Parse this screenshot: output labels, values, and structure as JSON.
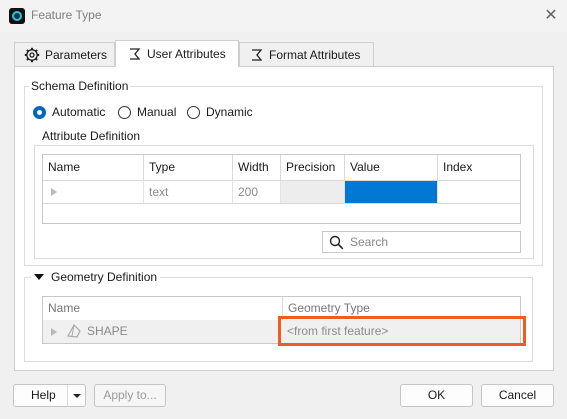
{
  "window": {
    "title": "Feature Type",
    "close_glyph": "✕",
    "icon": "app-icon"
  },
  "tabs": [
    {
      "label": "Parameters",
      "icon": "gear-icon",
      "active": false
    },
    {
      "label": "User Attributes",
      "icon": "sigma-icon",
      "active": true
    },
    {
      "label": "Format Attributes",
      "icon": "sigma-icon",
      "active": false
    }
  ],
  "schema": {
    "title": "Schema Definition",
    "options": [
      {
        "label": "Automatic",
        "checked": true
      },
      {
        "label": "Manual",
        "checked": false
      },
      {
        "label": "Dynamic",
        "checked": false
      }
    ]
  },
  "attributes": {
    "title": "Attribute Definition",
    "columns": [
      "Name",
      "Type",
      "Width",
      "Precision",
      "Value",
      "Index"
    ],
    "rows": [
      {
        "name": "",
        "type": "text",
        "width": "200",
        "precision": "",
        "value": "",
        "index": ""
      }
    ],
    "selected_color": "#0078d4"
  },
  "search": {
    "placeholder": "Search",
    "icon": "search-icon"
  },
  "geometry": {
    "title": "Geometry Definition",
    "expanded": true,
    "columns": [
      "Name",
      "Geometry Type"
    ],
    "rows": [
      {
        "name": "SHAPE",
        "geometry_type": "<from first feature>",
        "icon": "geometry-shape-icon"
      }
    ],
    "highlight_color": "#ef5d21"
  },
  "footer": {
    "help_label": "Help",
    "apply_label": "Apply to...",
    "ok_label": "OK",
    "cancel_label": "Cancel"
  }
}
